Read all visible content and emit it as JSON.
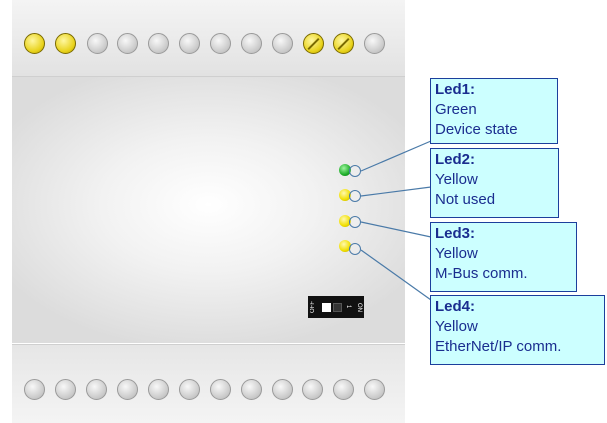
{
  "terminals": {
    "top": [
      "yellow",
      "yellow",
      "grey",
      "grey",
      "grey",
      "grey",
      "grey",
      "grey",
      "grey",
      "yellow-screw",
      "yellow-screw",
      "grey"
    ],
    "bottom": [
      "grey",
      "grey",
      "grey",
      "grey",
      "grey",
      "grey",
      "grey",
      "grey",
      "grey",
      "grey",
      "grey",
      "grey"
    ]
  },
  "dip_switch": {
    "off_label": "OFF",
    "on_label": "ON",
    "number": "1"
  },
  "callouts": [
    {
      "title": "Led1:",
      "color": "Green",
      "meaning": "Device state"
    },
    {
      "title": "Led2:",
      "color": "Yellow",
      "meaning": "Not used"
    },
    {
      "title": "Led3:",
      "color": "Yellow",
      "meaning": "M-Bus comm."
    },
    {
      "title": "Led4:",
      "color": "Yellow",
      "meaning": "EtherNet/IP comm."
    }
  ],
  "led_colors": [
    "green",
    "yellow",
    "yellow",
    "yellow"
  ]
}
